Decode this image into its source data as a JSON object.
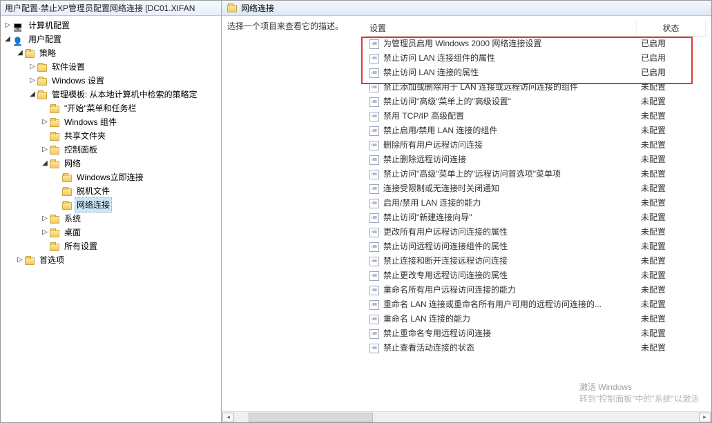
{
  "leftHeader": "用户配置·禁止XP管理员配置网络连接 [DC01.XIFAN",
  "tree": {
    "computer": {
      "label": "计算机配置"
    },
    "user": {
      "label": "用户配置"
    },
    "policy": {
      "label": "策略"
    },
    "softSettings": {
      "label": "软件设置"
    },
    "winSettings": {
      "label": "Windows 设置"
    },
    "adminTpl": {
      "label": "管理模板: 从本地计算机中检索的策略定"
    },
    "startMenu": {
      "label": "\"开始\"菜单和任务栏"
    },
    "winComponents": {
      "label": "Windows 组件"
    },
    "sharedFolders": {
      "label": "共享文件夹"
    },
    "controlPanel": {
      "label": "控制面板"
    },
    "network": {
      "label": "网络"
    },
    "winImmediate": {
      "label": "Windows立即连接"
    },
    "offlineFiles": {
      "label": "脱机文件"
    },
    "netConn": {
      "label": "网络连接"
    },
    "system": {
      "label": "系统"
    },
    "desktop": {
      "label": "桌面"
    },
    "allSettings": {
      "label": "所有设置"
    },
    "preferences": {
      "label": "首选项"
    }
  },
  "rightHeader": {
    "title": "网络连接"
  },
  "description": "选择一个项目来查看它的描述。",
  "columns": {
    "setting": "设置",
    "status": "状态"
  },
  "settings": [
    {
      "name": "为管理员启用 Windows 2000 网络连接设置",
      "status": "已启用"
    },
    {
      "name": "禁止访问 LAN 连接组件的属性",
      "status": "已启用"
    },
    {
      "name": "禁止访问 LAN 连接的属性",
      "status": "已启用"
    },
    {
      "name": "禁止添加或删除用于 LAN 连接或远程访问连接的组件",
      "status": "未配置"
    },
    {
      "name": "禁止访问\"高级\"菜单上的\"高级设置\"",
      "status": "未配置"
    },
    {
      "name": "禁用 TCP/IP 高级配置",
      "status": "未配置"
    },
    {
      "name": "禁止启用/禁用 LAN 连接的组件",
      "status": "未配置"
    },
    {
      "name": "删除所有用户远程访问连接",
      "status": "未配置"
    },
    {
      "name": "禁止删除远程访问连接",
      "status": "未配置"
    },
    {
      "name": "禁止访问\"高级\"菜单上的\"远程访问首选项\"菜单项",
      "status": "未配置"
    },
    {
      "name": "连接受限制或无连接时关闭通知",
      "status": "未配置"
    },
    {
      "name": "启用/禁用 LAN 连接的能力",
      "status": "未配置"
    },
    {
      "name": "禁止访问\"新建连接向导\"",
      "status": "未配置"
    },
    {
      "name": "更改所有用户远程访问连接的属性",
      "status": "未配置"
    },
    {
      "name": "禁止访问远程访问连接组件的属性",
      "status": "未配置"
    },
    {
      "name": "禁止连接和断开连接远程访问连接",
      "status": "未配置"
    },
    {
      "name": "禁止更改专用远程访问连接的属性",
      "status": "未配置"
    },
    {
      "name": "重命名所有用户远程访问连接的能力",
      "status": "未配置"
    },
    {
      "name": "重命名 LAN 连接或重命名所有用户可用的远程访问连接的...",
      "status": "未配置"
    },
    {
      "name": "重命名 LAN 连接的能力",
      "status": "未配置"
    },
    {
      "name": "禁止重命名专用远程访问连接",
      "status": "未配置"
    },
    {
      "name": "禁止查看活动连接的状态",
      "status": "未配置"
    }
  ],
  "watermark": {
    "line1": "激活 Windows",
    "line2": "转到\"控制面板\"中的\"系统\"以激活"
  }
}
